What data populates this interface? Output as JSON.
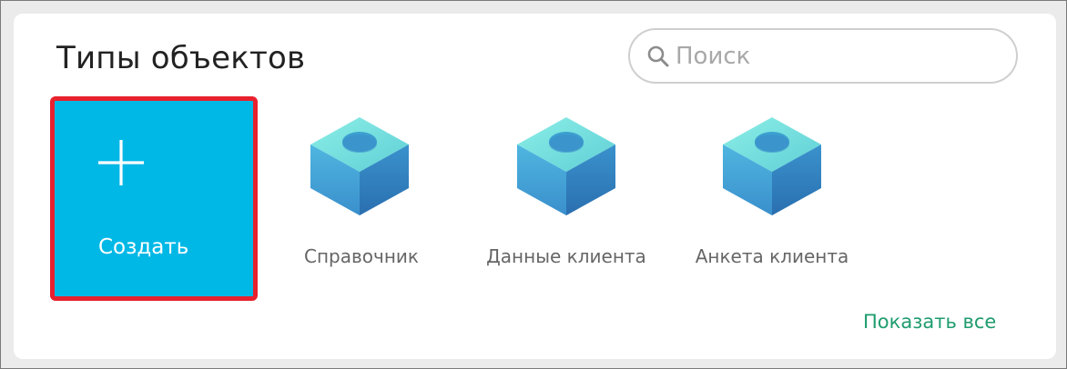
{
  "header": {
    "title": "Типы объектов"
  },
  "search": {
    "placeholder": "Поиск",
    "value": ""
  },
  "create_tile": {
    "label": "Создать",
    "icon": "plus-icon"
  },
  "object_types": [
    {
      "label": "Справочник",
      "icon": "cube-icon"
    },
    {
      "label": "Данные клиента",
      "icon": "cube-icon"
    },
    {
      "label": "Анкета клиента",
      "icon": "cube-icon"
    }
  ],
  "footer": {
    "show_all_label": "Показать все"
  },
  "colors": {
    "create_tile_bg": "#00b8e6",
    "selection_border": "#e8212e",
    "link": "#1e9c6e",
    "cube_top": "#7ee3df",
    "cube_left": "#3fa7d6",
    "cube_right": "#2f7fc0"
  }
}
